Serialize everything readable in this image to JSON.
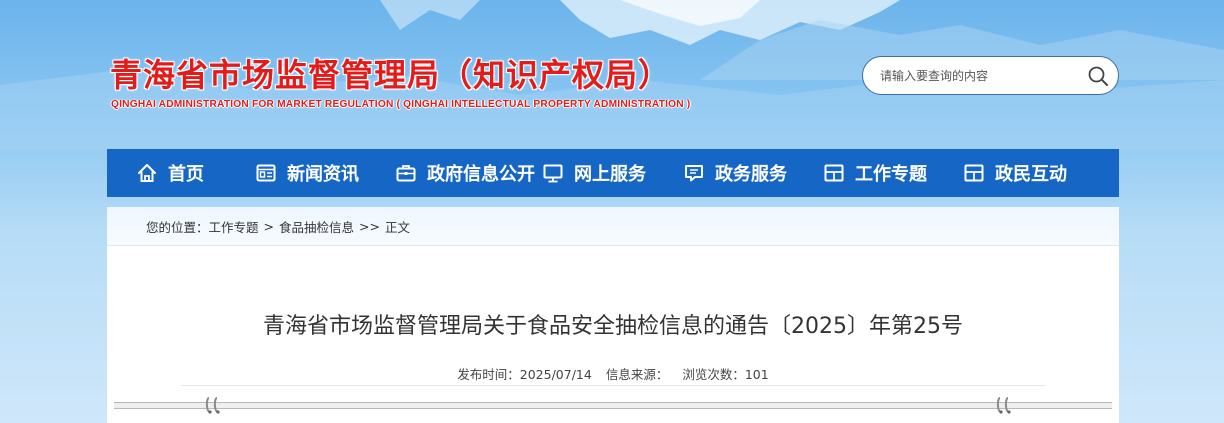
{
  "header": {
    "site_title": "青海省市场监督管理局（知识产权局）",
    "site_subtitle": "QINGHAI ADMINISTRATION FOR MARKET REGULATION ( QINGHAI INTELLECTUAL PROPERTY ADMINISTRATION )"
  },
  "search": {
    "placeholder": "请输入要查询的内容",
    "icon": "search-icon"
  },
  "nav": {
    "items": [
      {
        "label": "首页",
        "icon": "home-icon"
      },
      {
        "label": "新闻资讯",
        "icon": "news-icon"
      },
      {
        "label": "政府信息公开",
        "icon": "briefcase-icon"
      },
      {
        "label": "网上服务",
        "icon": "monitor-icon"
      },
      {
        "label": "政务服务",
        "icon": "chat-icon"
      },
      {
        "label": "工作专题",
        "icon": "layout-icon"
      },
      {
        "label": "政民互动",
        "icon": "layout-icon"
      }
    ]
  },
  "breadcrumb": {
    "prefix": "您的位置：",
    "items": [
      "工作专题",
      "食品抽检信息",
      "正文"
    ],
    "sep1": ">",
    "sep2": ">>"
  },
  "article": {
    "title": "青海省市场监督管理局关于食品安全抽检信息的通告〔2025〕年第25号",
    "publish_label": "发布时间：",
    "publish_date": "2025/07/14",
    "source_label": "信息来源：",
    "source_value": "",
    "views_label": "浏览次数：",
    "views": "101"
  },
  "colors": {
    "nav_bg": "#1667c5",
    "title_red": "#e21b1b",
    "sky": "#8cc7f2"
  }
}
